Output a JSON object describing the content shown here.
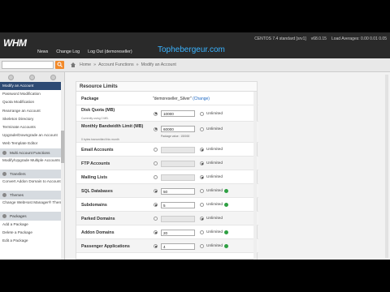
{
  "header": {
    "logo": "WHM",
    "nav": [
      "News",
      "Change Log",
      "Log Out (demoreseller)"
    ],
    "watermark": "Tophebergeur.com",
    "server": "CENTOS 7.4 standard [srv1]",
    "version": "v68.0.15",
    "load": "Load Averages: 0.00 0.01 0.05"
  },
  "breadcrumb": {
    "items": [
      "Home",
      "»",
      "Account Functions",
      "»",
      "Modify an Account"
    ]
  },
  "sidebar": {
    "items_top": [
      {
        "label": "Modify an Account",
        "active": true
      },
      {
        "label": "Password Modification"
      },
      {
        "label": "Quota Modification"
      },
      {
        "label": "Rearrange an Account"
      },
      {
        "label": "Skeleton Directory"
      },
      {
        "label": "Terminate Accounts"
      },
      {
        "label": "Upgrade/Downgrade an Account"
      },
      {
        "label": "Web Template Editor"
      }
    ],
    "section_multi": "Multi Account Functions",
    "multi_item": "Modify/Upgrade Multiple Accounts",
    "section_transfers": "Transfers",
    "transfer_item": "Convert Addon Domain to Account",
    "section_themes": "Themes",
    "theme_item": "Change WebHost Manager® Theme",
    "section_packages": "Packages",
    "package_items": [
      "Add a Package",
      "Delete a Package",
      "Edit a Package"
    ]
  },
  "panel": {
    "title": "Resource Limits",
    "package_label": "Package",
    "package_value": "\"demoreseller_Silver\"",
    "change_link": "(Change)",
    "rows": [
      {
        "label": "Disk Quota (MB)",
        "sub": "Currently using 0 MB.",
        "value": "10000",
        "choice": "value",
        "ok": false
      },
      {
        "label": "Monthly Bandwidth Limit (MB)",
        "sub": "0 bytes transmitted this month",
        "value": "60000",
        "note": "Package value : 150000",
        "choice": "value",
        "ok": false
      },
      {
        "label": "Email Accounts",
        "value": "",
        "choice": "unlimited",
        "ok": false
      },
      {
        "label": "FTP Accounts",
        "value": "",
        "choice": "unlimited",
        "ok": false
      },
      {
        "label": "Mailing Lists",
        "value": "",
        "choice": "unlimited",
        "ok": false
      },
      {
        "label": "SQL Databases",
        "value": "50",
        "choice": "value",
        "ok": true
      },
      {
        "label": "Subdomains",
        "value": "5",
        "choice": "value",
        "ok": true
      },
      {
        "label": "Parked Domains",
        "value": "",
        "choice": "unlimited",
        "ok": false
      },
      {
        "label": "Addon Domains",
        "value": "20",
        "choice": "value",
        "ok": true
      },
      {
        "label": "Passenger Applications",
        "value": "4",
        "choice": "value",
        "ok": true
      }
    ],
    "unlimited_label": "Unlimited"
  }
}
